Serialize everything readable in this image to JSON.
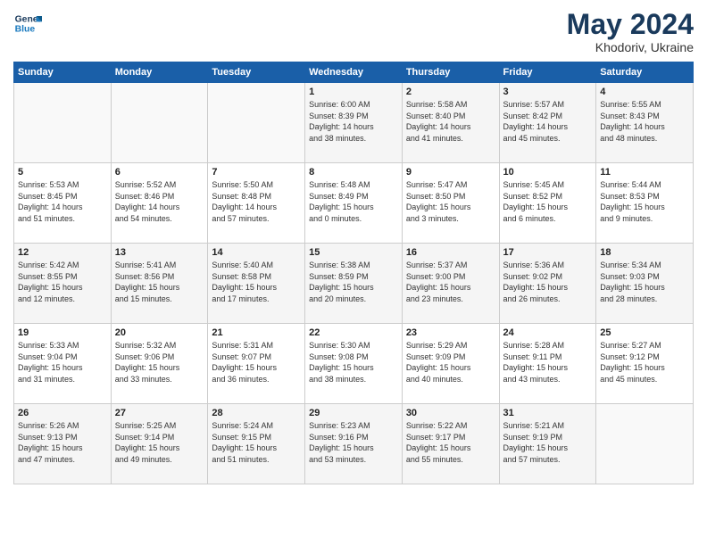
{
  "logo": {
    "line1": "General",
    "line2": "Blue"
  },
  "title": "May 2024",
  "subtitle": "Khodoriv, Ukraine",
  "headers": [
    "Sunday",
    "Monday",
    "Tuesday",
    "Wednesday",
    "Thursday",
    "Friday",
    "Saturday"
  ],
  "weeks": [
    [
      {
        "day": "",
        "info": ""
      },
      {
        "day": "",
        "info": ""
      },
      {
        "day": "",
        "info": ""
      },
      {
        "day": "1",
        "info": "Sunrise: 6:00 AM\nSunset: 8:39 PM\nDaylight: 14 hours\nand 38 minutes."
      },
      {
        "day": "2",
        "info": "Sunrise: 5:58 AM\nSunset: 8:40 PM\nDaylight: 14 hours\nand 41 minutes."
      },
      {
        "day": "3",
        "info": "Sunrise: 5:57 AM\nSunset: 8:42 PM\nDaylight: 14 hours\nand 45 minutes."
      },
      {
        "day": "4",
        "info": "Sunrise: 5:55 AM\nSunset: 8:43 PM\nDaylight: 14 hours\nand 48 minutes."
      }
    ],
    [
      {
        "day": "5",
        "info": "Sunrise: 5:53 AM\nSunset: 8:45 PM\nDaylight: 14 hours\nand 51 minutes."
      },
      {
        "day": "6",
        "info": "Sunrise: 5:52 AM\nSunset: 8:46 PM\nDaylight: 14 hours\nand 54 minutes."
      },
      {
        "day": "7",
        "info": "Sunrise: 5:50 AM\nSunset: 8:48 PM\nDaylight: 14 hours\nand 57 minutes."
      },
      {
        "day": "8",
        "info": "Sunrise: 5:48 AM\nSunset: 8:49 PM\nDaylight: 15 hours\nand 0 minutes."
      },
      {
        "day": "9",
        "info": "Sunrise: 5:47 AM\nSunset: 8:50 PM\nDaylight: 15 hours\nand 3 minutes."
      },
      {
        "day": "10",
        "info": "Sunrise: 5:45 AM\nSunset: 8:52 PM\nDaylight: 15 hours\nand 6 minutes."
      },
      {
        "day": "11",
        "info": "Sunrise: 5:44 AM\nSunset: 8:53 PM\nDaylight: 15 hours\nand 9 minutes."
      }
    ],
    [
      {
        "day": "12",
        "info": "Sunrise: 5:42 AM\nSunset: 8:55 PM\nDaylight: 15 hours\nand 12 minutes."
      },
      {
        "day": "13",
        "info": "Sunrise: 5:41 AM\nSunset: 8:56 PM\nDaylight: 15 hours\nand 15 minutes."
      },
      {
        "day": "14",
        "info": "Sunrise: 5:40 AM\nSunset: 8:58 PM\nDaylight: 15 hours\nand 17 minutes."
      },
      {
        "day": "15",
        "info": "Sunrise: 5:38 AM\nSunset: 8:59 PM\nDaylight: 15 hours\nand 20 minutes."
      },
      {
        "day": "16",
        "info": "Sunrise: 5:37 AM\nSunset: 9:00 PM\nDaylight: 15 hours\nand 23 minutes."
      },
      {
        "day": "17",
        "info": "Sunrise: 5:36 AM\nSunset: 9:02 PM\nDaylight: 15 hours\nand 26 minutes."
      },
      {
        "day": "18",
        "info": "Sunrise: 5:34 AM\nSunset: 9:03 PM\nDaylight: 15 hours\nand 28 minutes."
      }
    ],
    [
      {
        "day": "19",
        "info": "Sunrise: 5:33 AM\nSunset: 9:04 PM\nDaylight: 15 hours\nand 31 minutes."
      },
      {
        "day": "20",
        "info": "Sunrise: 5:32 AM\nSunset: 9:06 PM\nDaylight: 15 hours\nand 33 minutes."
      },
      {
        "day": "21",
        "info": "Sunrise: 5:31 AM\nSunset: 9:07 PM\nDaylight: 15 hours\nand 36 minutes."
      },
      {
        "day": "22",
        "info": "Sunrise: 5:30 AM\nSunset: 9:08 PM\nDaylight: 15 hours\nand 38 minutes."
      },
      {
        "day": "23",
        "info": "Sunrise: 5:29 AM\nSunset: 9:09 PM\nDaylight: 15 hours\nand 40 minutes."
      },
      {
        "day": "24",
        "info": "Sunrise: 5:28 AM\nSunset: 9:11 PM\nDaylight: 15 hours\nand 43 minutes."
      },
      {
        "day": "25",
        "info": "Sunrise: 5:27 AM\nSunset: 9:12 PM\nDaylight: 15 hours\nand 45 minutes."
      }
    ],
    [
      {
        "day": "26",
        "info": "Sunrise: 5:26 AM\nSunset: 9:13 PM\nDaylight: 15 hours\nand 47 minutes."
      },
      {
        "day": "27",
        "info": "Sunrise: 5:25 AM\nSunset: 9:14 PM\nDaylight: 15 hours\nand 49 minutes."
      },
      {
        "day": "28",
        "info": "Sunrise: 5:24 AM\nSunset: 9:15 PM\nDaylight: 15 hours\nand 51 minutes."
      },
      {
        "day": "29",
        "info": "Sunrise: 5:23 AM\nSunset: 9:16 PM\nDaylight: 15 hours\nand 53 minutes."
      },
      {
        "day": "30",
        "info": "Sunrise: 5:22 AM\nSunset: 9:17 PM\nDaylight: 15 hours\nand 55 minutes."
      },
      {
        "day": "31",
        "info": "Sunrise: 5:21 AM\nSunset: 9:19 PM\nDaylight: 15 hours\nand 57 minutes."
      },
      {
        "day": "",
        "info": ""
      }
    ]
  ]
}
